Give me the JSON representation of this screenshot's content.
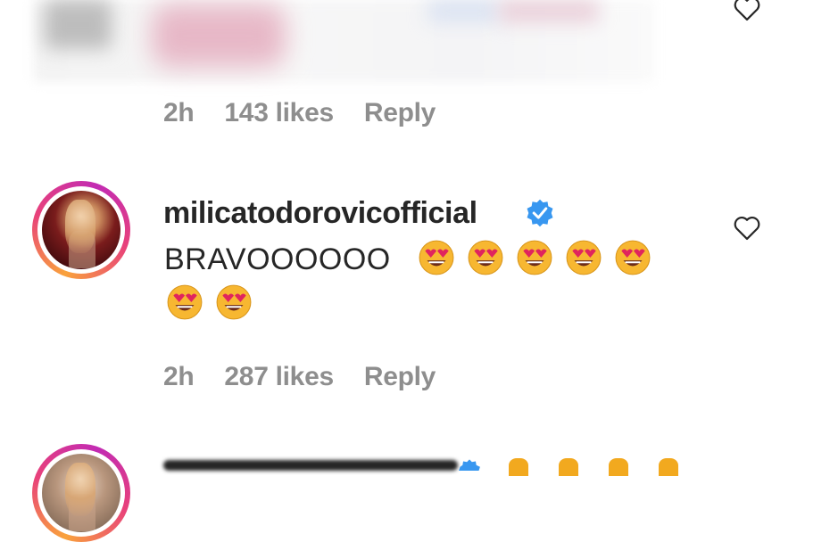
{
  "top_comment": {
    "time": "2h",
    "likes": "143 likes",
    "reply": "Reply"
  },
  "comment": {
    "username": "milicatodorovicofficial",
    "text": "BRAVOOOOOO",
    "emoji": "smiling-face-with-heart-eyes",
    "emoji_count": 7,
    "time": "2h",
    "likes": "287 likes",
    "reply": "Reply"
  },
  "colors": {
    "text": "#262626",
    "muted": "#8e8e8e",
    "verified": "#3897f0",
    "emoji_face": "#f7b731",
    "emoji_heart": "#e0245e"
  },
  "icons": {
    "like": "heart-icon",
    "verified": "verified-badge-icon"
  }
}
